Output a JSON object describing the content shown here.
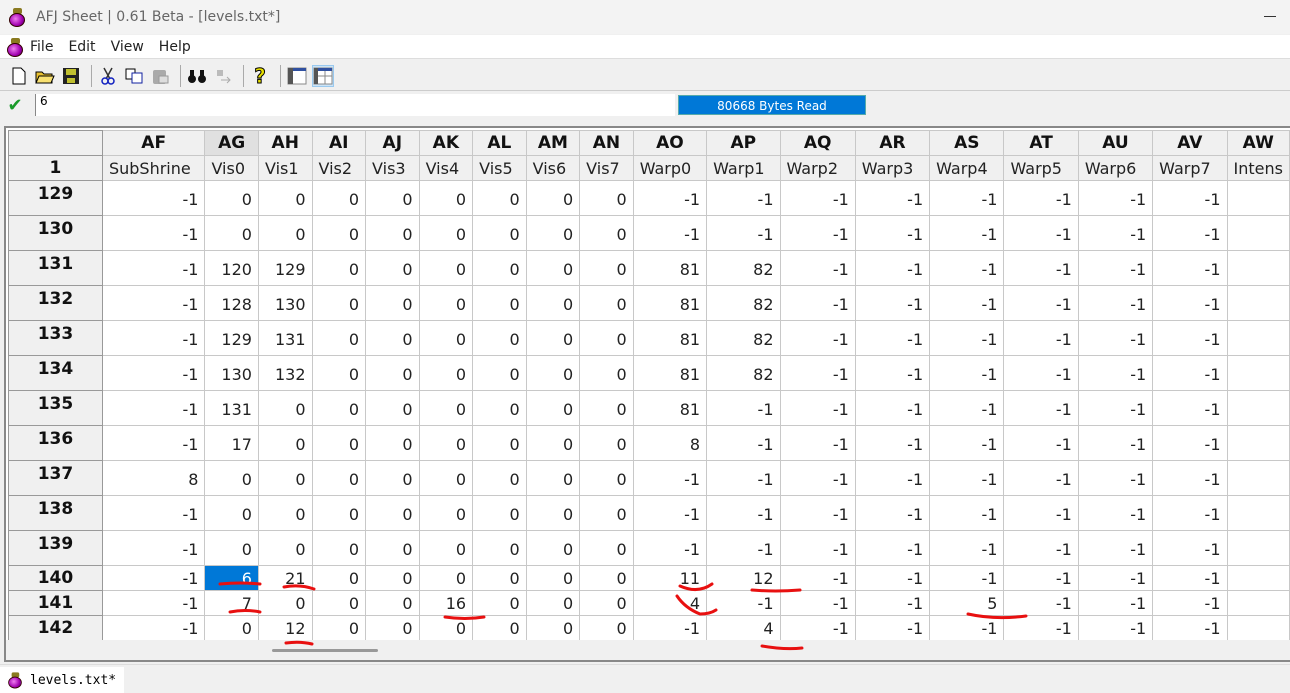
{
  "window": {
    "title": "AFJ Sheet | 0.61 Beta - [levels.txt*]"
  },
  "menu": [
    "File",
    "Edit",
    "View",
    "Help"
  ],
  "toolbar": {
    "icons": [
      "new-file-icon",
      "open-folder-icon",
      "save-icon",
      "cut-icon",
      "copy-icon",
      "paste-icon",
      "find-icon",
      "replace-icon",
      "help-icon",
      "view-list-icon",
      "view-grid-icon"
    ],
    "active": "view-grid-icon"
  },
  "edit": {
    "value": "6",
    "status": "80668 Bytes Read"
  },
  "grid": {
    "corner": "1",
    "columns": [
      {
        "letter": "AF",
        "name": "SubShrine"
      },
      {
        "letter": "AG",
        "name": "Vis0"
      },
      {
        "letter": "AH",
        "name": "Vis1"
      },
      {
        "letter": "AI",
        "name": "Vis2"
      },
      {
        "letter": "AJ",
        "name": "Vis3"
      },
      {
        "letter": "AK",
        "name": "Vis4"
      },
      {
        "letter": "AL",
        "name": "Vis5"
      },
      {
        "letter": "AM",
        "name": "Vis6"
      },
      {
        "letter": "AN",
        "name": "Vis7"
      },
      {
        "letter": "AO",
        "name": "Warp0"
      },
      {
        "letter": "AP",
        "name": "Warp1"
      },
      {
        "letter": "AQ",
        "name": "Warp2"
      },
      {
        "letter": "AR",
        "name": "Warp3"
      },
      {
        "letter": "AS",
        "name": "Warp4"
      },
      {
        "letter": "AT",
        "name": "Warp5"
      },
      {
        "letter": "AU",
        "name": "Warp6"
      },
      {
        "letter": "AV",
        "name": "Warp7"
      },
      {
        "letter": "AW",
        "name": "Intens"
      }
    ],
    "selected": {
      "row": "140",
      "column": "AG"
    },
    "rows": [
      {
        "id": "129",
        "cells": [
          "-1",
          "0",
          "0",
          "0",
          "0",
          "0",
          "0",
          "0",
          "0",
          "-1",
          "-1",
          "-1",
          "-1",
          "-1",
          "-1",
          "-1",
          "-1",
          ""
        ]
      },
      {
        "id": "130",
        "cells": [
          "-1",
          "0",
          "0",
          "0",
          "0",
          "0",
          "0",
          "0",
          "0",
          "-1",
          "-1",
          "-1",
          "-1",
          "-1",
          "-1",
          "-1",
          "-1",
          ""
        ]
      },
      {
        "id": "131",
        "cells": [
          "-1",
          "120",
          "129",
          "0",
          "0",
          "0",
          "0",
          "0",
          "0",
          "81",
          "82",
          "-1",
          "-1",
          "-1",
          "-1",
          "-1",
          "-1",
          ""
        ]
      },
      {
        "id": "132",
        "cells": [
          "-1",
          "128",
          "130",
          "0",
          "0",
          "0",
          "0",
          "0",
          "0",
          "81",
          "82",
          "-1",
          "-1",
          "-1",
          "-1",
          "-1",
          "-1",
          ""
        ]
      },
      {
        "id": "133",
        "cells": [
          "-1",
          "129",
          "131",
          "0",
          "0",
          "0",
          "0",
          "0",
          "0",
          "81",
          "82",
          "-1",
          "-1",
          "-1",
          "-1",
          "-1",
          "-1",
          ""
        ]
      },
      {
        "id": "134",
        "cells": [
          "-1",
          "130",
          "132",
          "0",
          "0",
          "0",
          "0",
          "0",
          "0",
          "81",
          "82",
          "-1",
          "-1",
          "-1",
          "-1",
          "-1",
          "-1",
          ""
        ]
      },
      {
        "id": "135",
        "cells": [
          "-1",
          "131",
          "0",
          "0",
          "0",
          "0",
          "0",
          "0",
          "0",
          "81",
          "-1",
          "-1",
          "-1",
          "-1",
          "-1",
          "-1",
          "-1",
          ""
        ]
      },
      {
        "id": "136",
        "cells": [
          "-1",
          "17",
          "0",
          "0",
          "0",
          "0",
          "0",
          "0",
          "0",
          "8",
          "-1",
          "-1",
          "-1",
          "-1",
          "-1",
          "-1",
          "-1",
          ""
        ]
      },
      {
        "id": "137",
        "cells": [
          "8",
          "0",
          "0",
          "0",
          "0",
          "0",
          "0",
          "0",
          "0",
          "-1",
          "-1",
          "-1",
          "-1",
          "-1",
          "-1",
          "-1",
          "-1",
          ""
        ]
      },
      {
        "id": "138",
        "cells": [
          "-1",
          "0",
          "0",
          "0",
          "0",
          "0",
          "0",
          "0",
          "0",
          "-1",
          "-1",
          "-1",
          "-1",
          "-1",
          "-1",
          "-1",
          "-1",
          ""
        ]
      },
      {
        "id": "139",
        "cells": [
          "-1",
          "0",
          "0",
          "0",
          "0",
          "0",
          "0",
          "0",
          "0",
          "-1",
          "-1",
          "-1",
          "-1",
          "-1",
          "-1",
          "-1",
          "-1",
          ""
        ]
      },
      {
        "id": "140",
        "cells": [
          "-1",
          "6",
          "21",
          "0",
          "0",
          "0",
          "0",
          "0",
          "0",
          "11",
          "12",
          "-1",
          "-1",
          "-1",
          "-1",
          "-1",
          "-1",
          ""
        ]
      },
      {
        "id": "141",
        "cells": [
          "-1",
          "7",
          "0",
          "0",
          "0",
          "16",
          "0",
          "0",
          "0",
          "4",
          "-1",
          "-1",
          "-1",
          "5",
          "-1",
          "-1",
          "-1",
          ""
        ]
      },
      {
        "id": "142",
        "cells": [
          "-1",
          "0",
          "12",
          "0",
          "0",
          "0",
          "0",
          "0",
          "0",
          "-1",
          "4",
          "-1",
          "-1",
          "-1",
          "-1",
          "-1",
          "-1",
          ""
        ]
      }
    ]
  },
  "tabs": [
    {
      "label": "levels.txt*"
    }
  ],
  "colors": {
    "selection": "#0078d7",
    "annotation": "#e81010",
    "check": "#1a9a2a"
  }
}
